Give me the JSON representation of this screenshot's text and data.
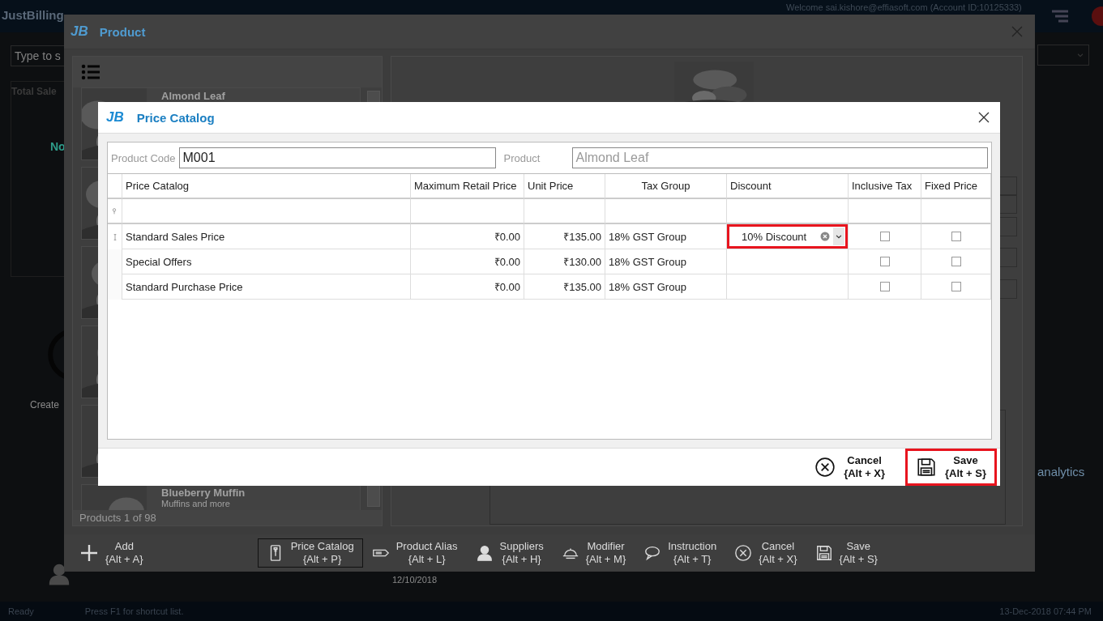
{
  "app": {
    "title": "JustBilling",
    "welcome": "Welcome sai.kishore@effiasoft.com (Account ID:10125333)",
    "search_placeholder": "Type to s",
    "total_sales": "Total Sale",
    "no_label": "No",
    "create_label": "Create",
    "analytics": "analytics",
    "date": "12/10/2018"
  },
  "product_window": {
    "logo": "JB",
    "title": "Product",
    "items": [
      {
        "kind": "card",
        "name": "Almond Leaf"
      },
      {
        "kind": "card"
      },
      {
        "kind": "card"
      },
      {
        "kind": "card"
      },
      {
        "kind": "card"
      },
      {
        "kind": "card",
        "name": "Blueberry Muffin",
        "description": "Muffins and more"
      }
    ],
    "count": "Products 1 of 98",
    "toolbar": [
      {
        "kind": "plus",
        "label": "Add",
        "shortcut": "{Alt + A}",
        "selected": false
      },
      {
        "kind": "card",
        "label": "Price Catalog",
        "shortcut": "{Alt + P}",
        "selected": true
      },
      {
        "kind": "tag",
        "label": "Product Alias",
        "shortcut": "{Alt + L}",
        "selected": false
      },
      {
        "kind": "person",
        "label": "Suppliers",
        "shortcut": "{Alt + H}",
        "selected": false
      },
      {
        "kind": "dish",
        "label": "Modifier",
        "shortcut": "{Alt + M}",
        "selected": false
      },
      {
        "kind": "bubble",
        "label": "Instruction",
        "shortcut": "{Alt + T}",
        "selected": false
      },
      {
        "kind": "cancel",
        "label": "Cancel",
        "shortcut": "{Alt + X}",
        "selected": false
      },
      {
        "kind": "save",
        "label": "Save",
        "shortcut": "{Alt + S}",
        "selected": false
      }
    ]
  },
  "dialog": {
    "logo": "JB",
    "title": "Price Catalog",
    "product_code_label": "Product Code",
    "product_code": "M001",
    "product_label": "Product",
    "product": "Almond Leaf",
    "columns": [
      "Price Catalog",
      "Maximum Retail Price",
      "Unit Price",
      "Tax Group",
      "Discount",
      "Inclusive Tax",
      "Fixed Price"
    ],
    "rows": [
      {
        "current": true,
        "catalog": "Standard Sales Price",
        "mrp": "₹0.00",
        "unit_price": "₹135.00",
        "tax_group": "18% GST Group",
        "discount": "10% Discount",
        "highlighted": true,
        "inclusive_tax": false,
        "fixed_price": false
      },
      {
        "current": false,
        "catalog": "Special Offers",
        "mrp": "₹0.00",
        "unit_price": "₹130.00",
        "tax_group": "18% GST Group",
        "highlighted": false,
        "inclusive_tax": false,
        "fixed_price": false
      },
      {
        "current": false,
        "catalog": "Standard Purchase Price",
        "mrp": "₹0.00",
        "unit_price": "₹135.00",
        "tax_group": "18% GST Group",
        "highlighted": false,
        "inclusive_tax": false,
        "fixed_price": false
      }
    ],
    "buttons": [
      {
        "kind": "cancel",
        "label": "Cancel",
        "shortcut": "{Alt + X}",
        "highlighted": false
      },
      {
        "kind": "save",
        "label": "Save",
        "shortcut": "{Alt + S}",
        "highlighted": true
      }
    ]
  },
  "status_bar": {
    "state": "Ready",
    "hint": "Press F1 for shortcut list.",
    "datetime": "13-Dec-2018 07:44 PM"
  }
}
